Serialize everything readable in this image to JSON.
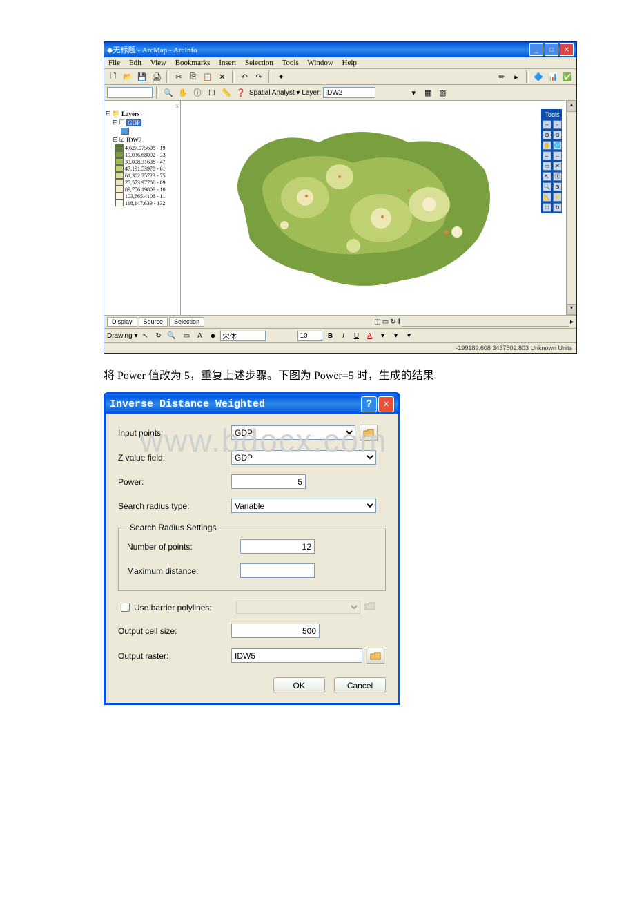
{
  "arcmap": {
    "title": "无标题 - ArcMap - ArcInfo",
    "menu": {
      "file": "File",
      "edit": "Edit",
      "view": "View",
      "bookmarks": "Bookmarks",
      "insert": "Insert",
      "selection": "Selection",
      "tools": "Tools",
      "window": "Window",
      "help": "Help"
    },
    "toolbar": {
      "spatial_analyst": "Spatial Analyst ▾",
      "layer_label": "Layer:",
      "layer_value": "IDW2"
    },
    "toc": {
      "root": "Layers",
      "layer_gdp": "GDP",
      "layer_idw2": "IDW2",
      "legend": [
        {
          "color": "#5a7a2e",
          "label": "4,627.075608 - 19"
        },
        {
          "color": "#7a9f3f",
          "label": "19,036.68092 - 33"
        },
        {
          "color": "#9fbc56",
          "label": "33,008.31638 - 47"
        },
        {
          "color": "#c0d174",
          "label": "47,191.53978 - 61"
        },
        {
          "color": "#d9e095",
          "label": "61,302.75723 - 75"
        },
        {
          "color": "#ece8b3",
          "label": "75,573.97706 - 89"
        },
        {
          "color": "#f5eec9",
          "label": "89,756.19809 - 10"
        },
        {
          "color": "#faf4dc",
          "label": "103,865.4108 - 11"
        },
        {
          "color": "#fdfaea",
          "label": "118,147.639 - 132"
        }
      ],
      "tabs": {
        "display": "Display",
        "source": "Source",
        "selection": "Selection"
      }
    },
    "tools_panel": "Tools",
    "drawing": "Drawing ▾",
    "font_label": "宋体",
    "status": "-199189.608  3437502.803 Unknown Units"
  },
  "caption": "将 Power 值改为 5，重复上述步骤。下图为 Power=5 时，生成的结果",
  "watermark": "www.bdocx.com",
  "idw": {
    "title": "Inverse Distance Weighted",
    "labels": {
      "input_points": "Input points:",
      "z_field": "Z value field:",
      "power": "Power:",
      "radius_type": "Search radius type:",
      "radius_settings": "Search Radius Settings",
      "num_points": "Number of points:",
      "max_dist": "Maximum distance:",
      "barrier": "Use barrier polylines:",
      "cell_size": "Output cell size:",
      "output": "Output raster:",
      "ok": "OK",
      "cancel": "Cancel"
    },
    "values": {
      "input_points": "GDP",
      "z_field": "GDP",
      "power": "5",
      "radius_type": "Variable",
      "num_points": "12",
      "max_dist": "",
      "cell_size": "500",
      "output": "IDW5"
    }
  }
}
